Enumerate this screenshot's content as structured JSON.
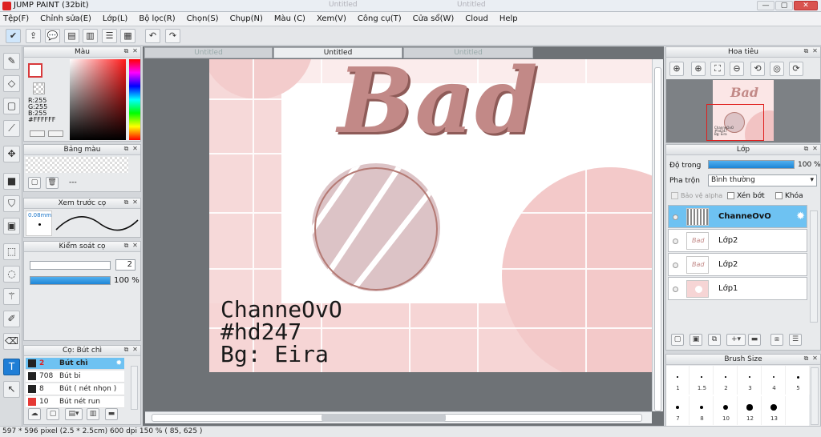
{
  "window": {
    "title": "JUMP PAINT (32bit)",
    "background_tabs": [
      "Untitled",
      "Untitled"
    ],
    "buttons": [
      "—",
      "▢",
      "✕"
    ]
  },
  "menu": [
    "Tệp(F)",
    "Chỉnh sửa(E)",
    "Lớp(L)",
    "Bộ lọc(R)",
    "Chọn(S)",
    "Chụp(N)",
    "Màu (C)",
    "Xem(V)",
    "Công cụ(T)",
    "Cửa sổ(W)",
    "Cloud",
    "Help"
  ],
  "color_panel": {
    "title": "Màu",
    "r": "R:255",
    "g": "G:255",
    "b": "B:255",
    "hex": "#FFFFFF",
    "accent": "#d8393b"
  },
  "palette_panel": {
    "title": "Bảng màu",
    "placeholder": "---"
  },
  "brush_preview": {
    "title": "Xem trước cọ",
    "size": "0.08mm"
  },
  "brush_control": {
    "title": "Kiểm soát cọ",
    "size_value": "2",
    "opacity": "100 %",
    "opacity_fraction": 1.0
  },
  "pencil_panel": {
    "title": "Cọ: Bút chì",
    "items": [
      {
        "size": "2",
        "name": "Bút chì",
        "color": "#222222"
      },
      {
        "size": "708",
        "name": "Bút bi",
        "color": "#222222"
      },
      {
        "size": "8",
        "name": "Bút ( nét nhọn )",
        "color": "#222222"
      },
      {
        "size": "10",
        "name": "Bút nét run",
        "color": "#e53935"
      }
    ]
  },
  "document": {
    "tabs": [
      "Untitled",
      "Untitled",
      "Untitled"
    ],
    "active_tab": 1,
    "canvas_text": [
      "ChanneOvO",
      "#hd247",
      "Bg: Eira"
    ],
    "canvas_title": "Bad"
  },
  "navigator": {
    "title": "Hoa tiêu",
    "preview_lines": [
      "ChanneOvO",
      "#hd247",
      "Bg: Eira"
    ]
  },
  "layers": {
    "title": "Lớp",
    "opacity_label": "Độ trong",
    "opacity_value": "100 %",
    "opacity_fraction": 1.0,
    "blend_label": "Pha trộn",
    "blend_value": "Bình thường",
    "protect_alpha": "Bảo vệ alpha",
    "clipping": "Xén bớt",
    "lock": "Khóa",
    "items": [
      {
        "name": "ChanneOvO",
        "selected": true
      },
      {
        "name": "Lớp2",
        "selected": false
      },
      {
        "name": "Lớp2",
        "selected": false
      },
      {
        "name": "Lớp1",
        "selected": false
      }
    ]
  },
  "brush_size": {
    "title": "Brush Size",
    "labels_row1": [
      "1",
      "1.5",
      "2",
      "3",
      "4",
      "5"
    ],
    "labels_row2": [
      "7",
      "8",
      "10",
      "12",
      "13"
    ]
  },
  "status": "597 * 596 pixel   (2.5 * 2.5cm)   600 dpi   150 %   ( 85, 625 )"
}
